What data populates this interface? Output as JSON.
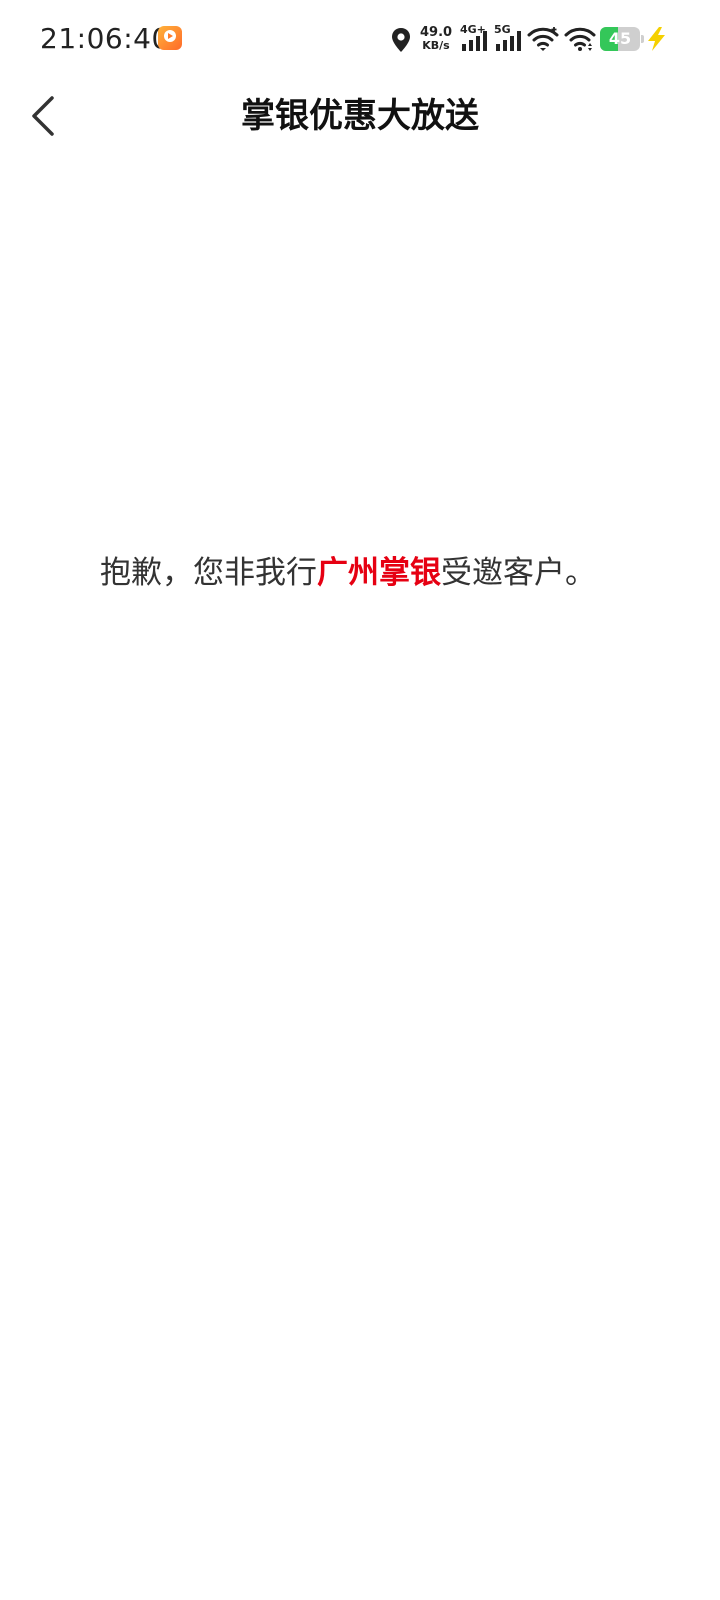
{
  "status_bar": {
    "time": "21:06:40",
    "net_speed_value": "49.0",
    "net_speed_unit": "KB/s",
    "sim1_label": "4G+",
    "sim2_label": "5G",
    "battery_level": "45",
    "battery_fraction": 0.45,
    "icons": [
      "app-notification-icon",
      "location-icon",
      "signal-icon",
      "wifi-icon",
      "battery-icon",
      "charging-icon"
    ]
  },
  "header": {
    "title": "掌银优惠大放送",
    "back_icon": "chevron-left-icon"
  },
  "main": {
    "message_prefix": "抱歉，您非我行",
    "message_highlight": "广州掌银",
    "message_suffix": "受邀客户。"
  },
  "colors": {
    "highlight": "#e60012",
    "battery_fill": "#34c759"
  }
}
